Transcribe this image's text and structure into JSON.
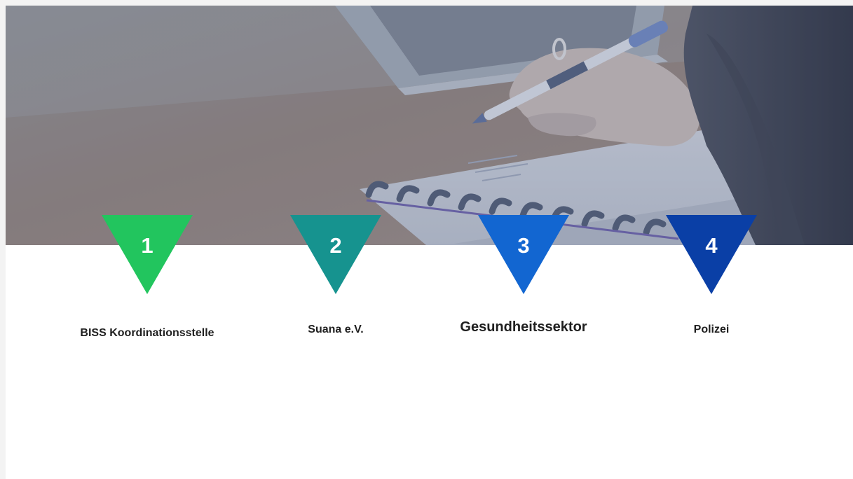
{
  "steps": [
    {
      "number": "1",
      "label": "BISS Koordinationsstelle",
      "color": "#22c55e"
    },
    {
      "number": "2",
      "label": "Suana e.V.",
      "color": "#16938f"
    },
    {
      "number": "3",
      "label": "Gesundheitssektor",
      "color": "#1266d1"
    },
    {
      "number": "4",
      "label": "Polizei",
      "color": "#0a3fa6"
    }
  ],
  "header_image": {
    "description_icon": "writing-hand-photo",
    "overlay_color": "#5a6a8a"
  }
}
